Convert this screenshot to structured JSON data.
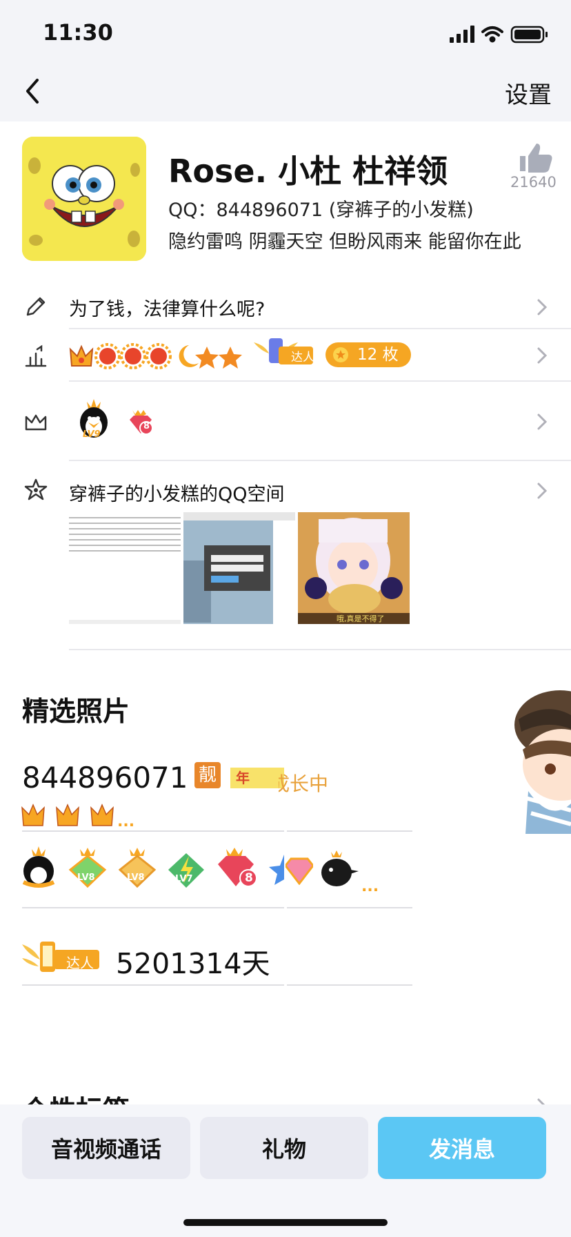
{
  "status": {
    "time": "11:30"
  },
  "nav": {
    "settings": "设置"
  },
  "profile": {
    "name": "Rose. 小杜 杜祥领",
    "qq_line": "QQ：844896071 (穿裤子的小发糕)",
    "signature": "隐约雷鸣 阴霾天空 但盼风雨来 能留你在此",
    "likes": "21640"
  },
  "rows": {
    "motto": "为了钱，法律算什么呢?",
    "badge_text": "达人",
    "medal_count": "12 枚",
    "level_label": "LV9",
    "gem_label": "8",
    "qzone_title": "穿裤子的小发糕的QQ空间",
    "thumb3_caption": "哦,真是不得了"
  },
  "featured": {
    "title": "精选照片",
    "number": "844896071",
    "liang": "靓",
    "svip": "年SVIP",
    "growing": "成长中",
    "ellipsis": "...",
    "levels": [
      "LV8",
      "LV8",
      "LV7",
      "8"
    ],
    "daren": "达人",
    "days": "5201314天"
  },
  "next_section": {
    "title": "个性标签"
  },
  "buttons": {
    "call": "音视频通话",
    "gift": "礼物",
    "message": "发消息"
  },
  "colors": {
    "accent_blue": "#5bc7f4",
    "medal_orange": "#f5a623",
    "growing_orange": "#e8a13a"
  }
}
